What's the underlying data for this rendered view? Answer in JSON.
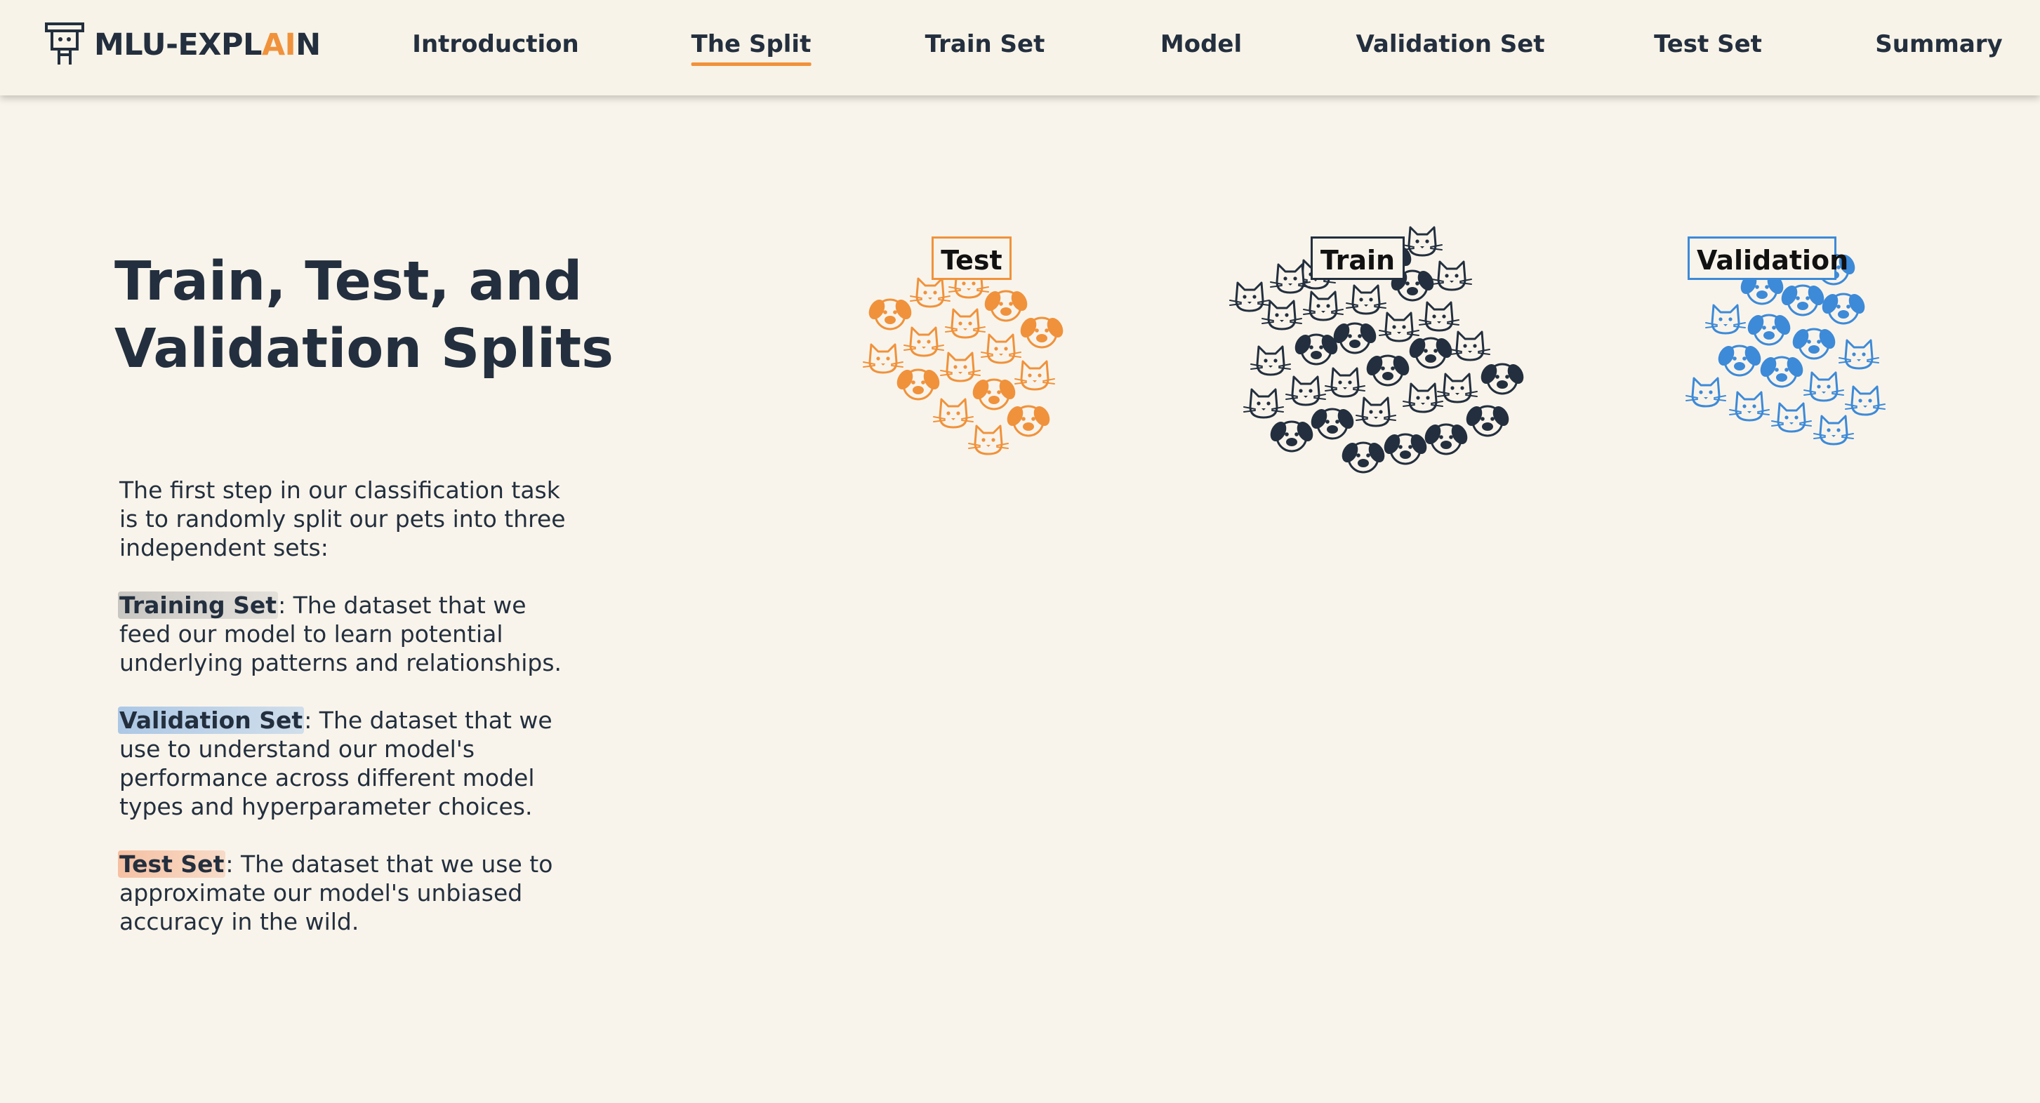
{
  "header": {
    "logo_text_main": "MLU-EXPL",
    "logo_text_accent": "AI",
    "logo_text_end": "N",
    "logo_icon": "robot-icon",
    "nav": [
      {
        "label": "Introduction",
        "active": false
      },
      {
        "label": "The Split",
        "active": true
      },
      {
        "label": "Train Set",
        "active": false
      },
      {
        "label": "Model",
        "active": false
      },
      {
        "label": "Validation Set",
        "active": false
      },
      {
        "label": "Test Set",
        "active": false
      },
      {
        "label": "Summary",
        "active": false
      }
    ]
  },
  "main": {
    "title": "Train, Test, and Validation Splits",
    "intro": "The first step in our classification task is to randomly split our pets into three independent sets:",
    "definitions": [
      {
        "term": "Training Set",
        "text": ": The dataset that we feed our model to learn potential underlying patterns and relationships."
      },
      {
        "term": "Validation Set",
        "text": ": The dataset that we use to understand our model's performance across different model types and hyperparameter choices."
      },
      {
        "term": "Test Set",
        "text": ": The dataset that we use to approximate our model's unbiased accuracy in the wild."
      }
    ]
  },
  "groups": [
    {
      "label": "Test",
      "color": "#f0923b",
      "icons": [
        "cat-icon",
        "dog-icon"
      ]
    },
    {
      "label": "Train",
      "color": "#232f3e",
      "icons": [
        "cat-icon",
        "dog-icon"
      ]
    },
    {
      "label": "Validation",
      "color": "#3d8ad8",
      "icons": [
        "cat-icon",
        "dog-icon"
      ]
    }
  ],
  "colors": {
    "accent": "#f0923b",
    "dark": "#232f3e",
    "blue": "#3d8ad8",
    "background": "#f9f4eb"
  }
}
